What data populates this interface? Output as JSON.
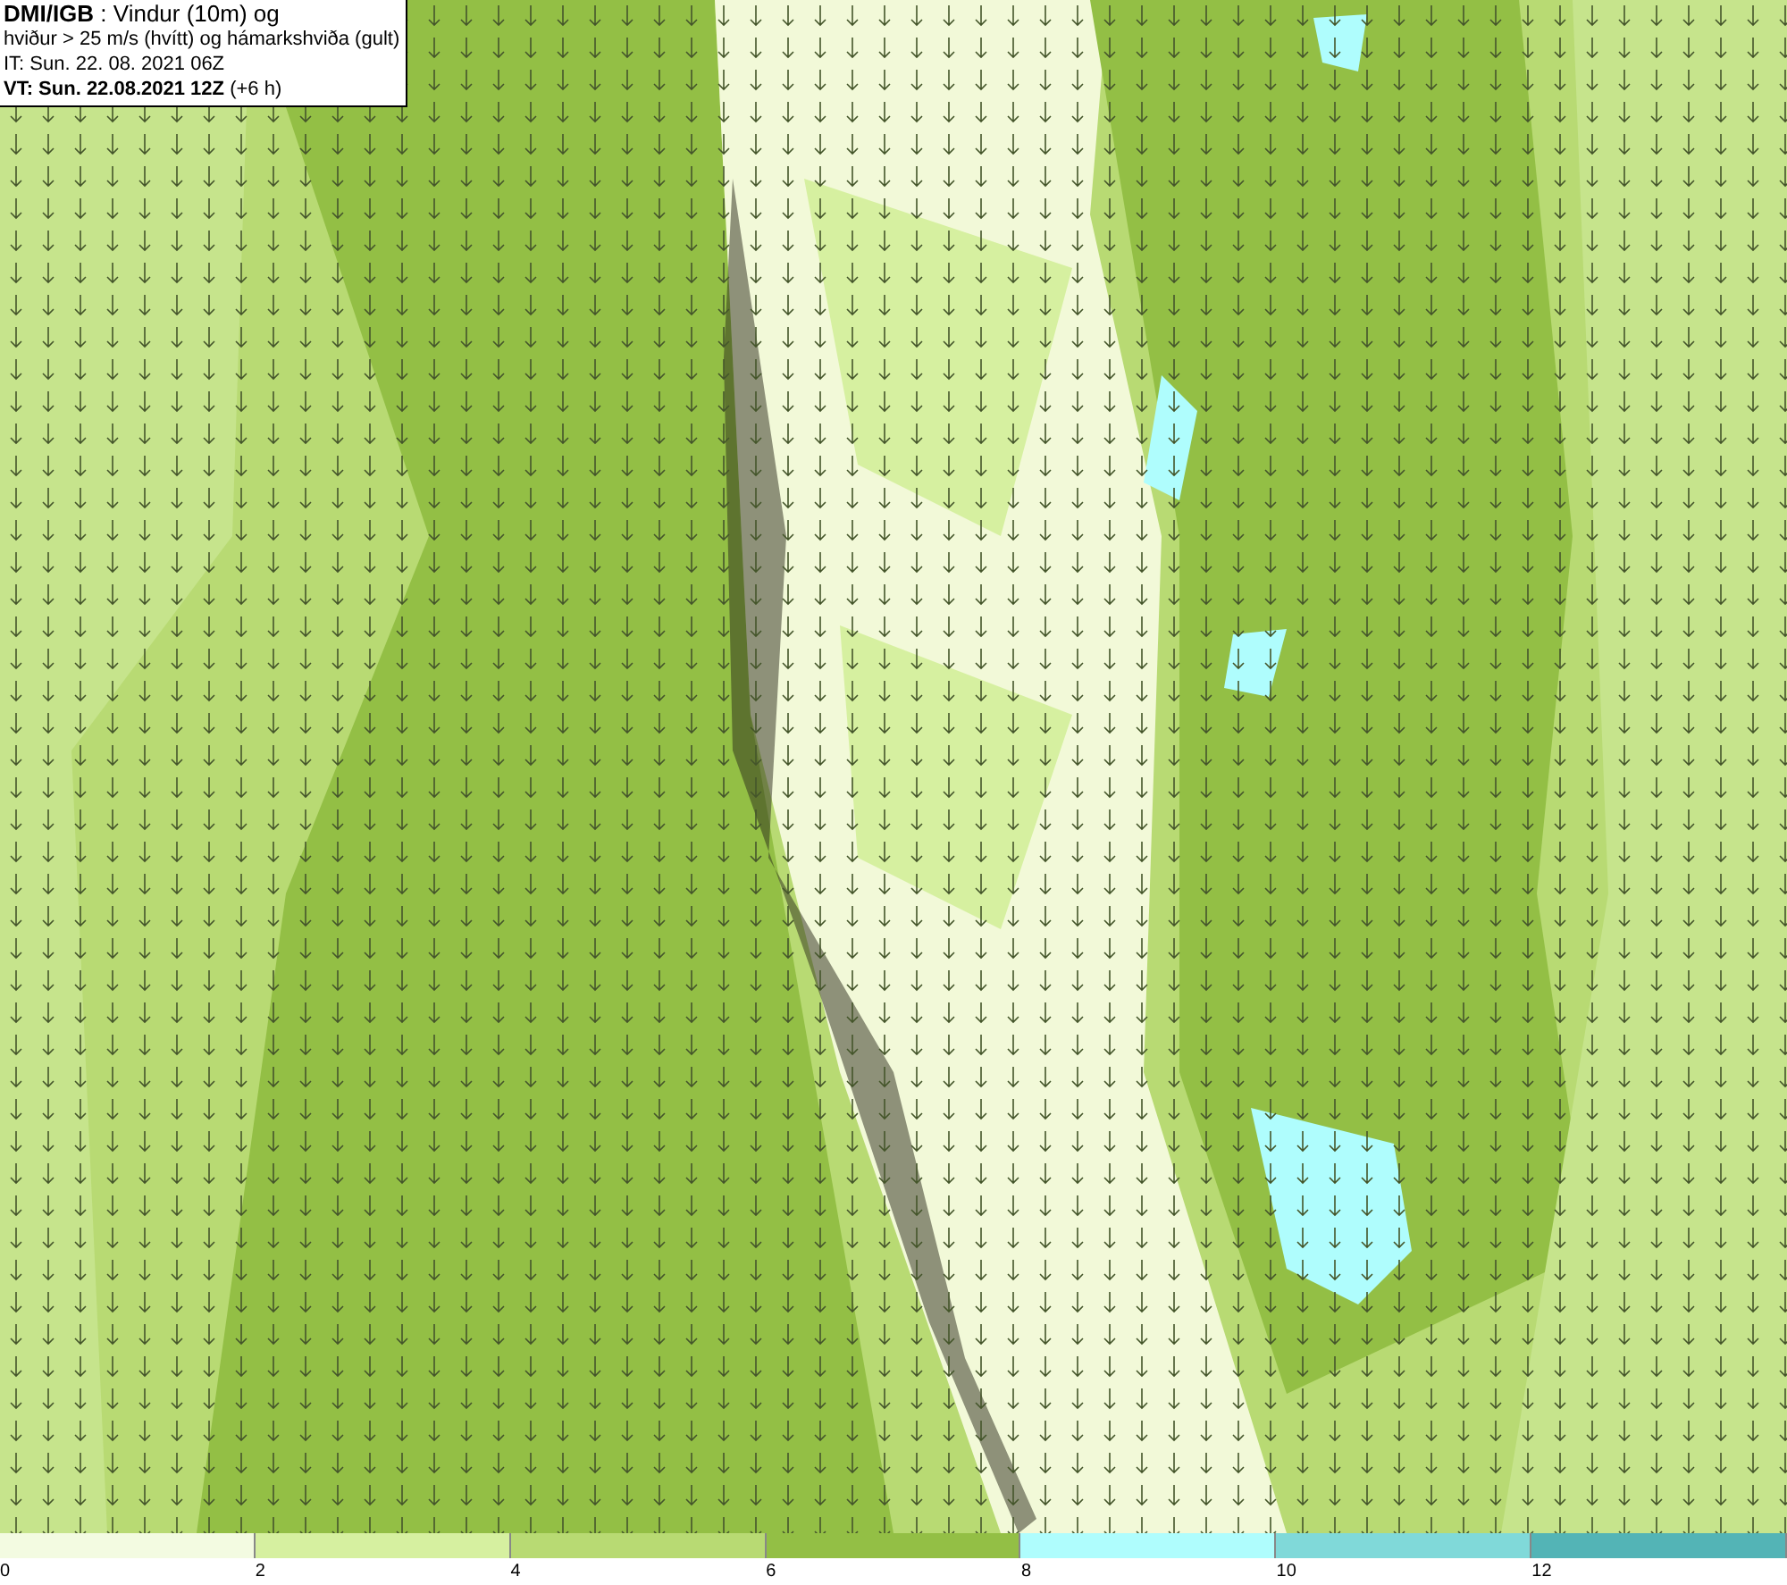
{
  "info_box": {
    "lines": [
      "**DMI/IGB** : Vindur (10m) og",
      "hviður > 25 m/s (hvítt) og hámarkshviða (gult)",
      "IT: Sun. 22. 08. 2021 06Z",
      "**VT: Sun. 22.08.2021 12Z** (+6 h)"
    ]
  },
  "legend": {
    "segments": [
      {
        "color": "#f3fbe1"
      },
      {
        "color": "#d6f0a0"
      },
      {
        "color": "#b8da73"
      },
      {
        "color": "#93bf45"
      },
      {
        "color": "#affdfd"
      },
      {
        "color": "#80d9d9"
      },
      {
        "color": "#53b4b6"
      }
    ],
    "ticks": [
      "0",
      "2",
      "4",
      "6",
      "8",
      "10",
      "12"
    ]
  }
}
